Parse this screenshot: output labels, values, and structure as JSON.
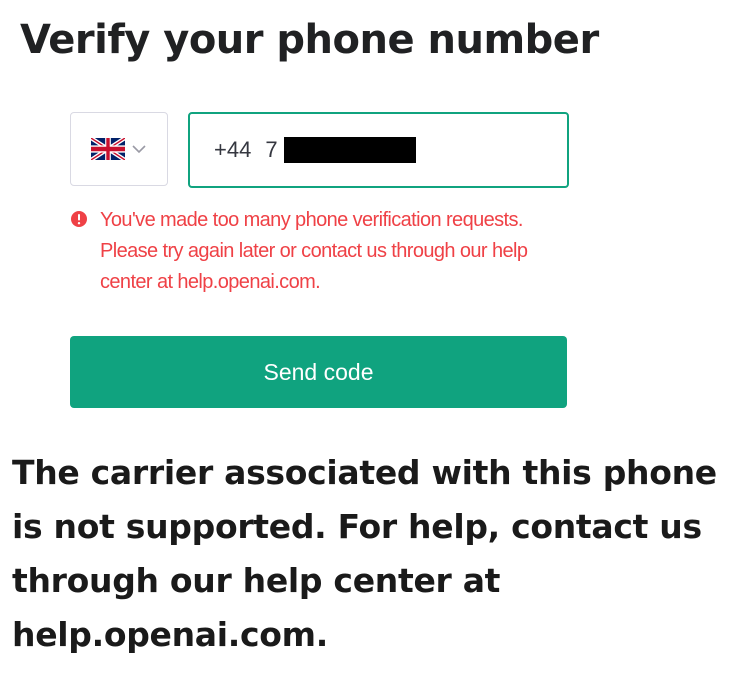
{
  "page": {
    "title": "Verify your phone number"
  },
  "phone_form": {
    "country_flag_icon": "uk-flag-icon",
    "dropdown_icon": "chevron-down-icon",
    "dial_code": "+44",
    "number_prefix": "7",
    "number_redacted": true,
    "accent_color": "#10a37f",
    "error": {
      "icon": "alert-circle-icon",
      "color": "#ef4146",
      "message": "You've made too many phone verification requests. Please try again later or contact us through our help center at help.openai.com."
    },
    "send_button_label": "Send code"
  },
  "caption": {
    "text": "The carrier associated with this phone is not supported. For help, contact us through our help center at help.openai.com."
  }
}
